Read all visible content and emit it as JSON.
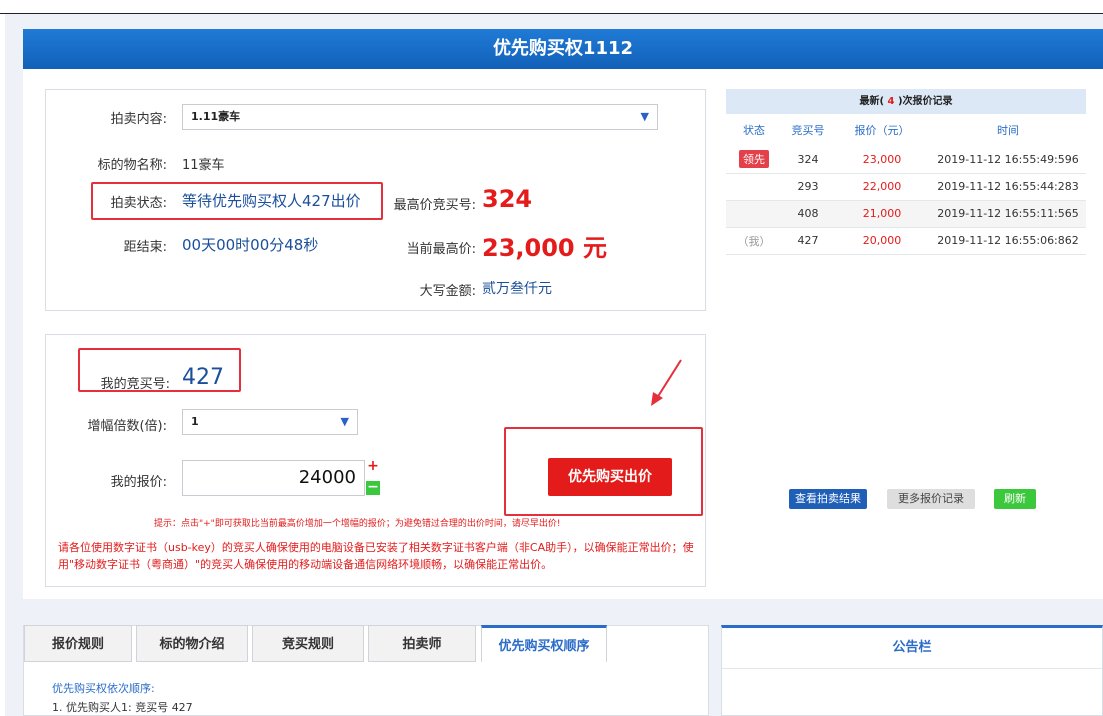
{
  "banner": {
    "title": "优先购买权1112"
  },
  "auction": {
    "content_label": "拍卖内容:",
    "content_value": "1.11豪车",
    "item_name_label": "标的物名称:",
    "item_name_value": "11豪车",
    "status_label": "拍卖状态:",
    "status_value": "等待优先购买权人427出价",
    "highest_bidder_label": "最高价竞买号:",
    "highest_bidder_value": "324",
    "countdown_label": "距结束:",
    "countdown_value": "00天00时00分48秒",
    "current_price_label": "当前最高价:",
    "current_price_value": "23,000 元",
    "capital_amount_label": "大写金额:",
    "capital_amount_value": "贰万叁仟元"
  },
  "bid": {
    "my_number_label": "我的竞买号:",
    "my_number_value": "427",
    "multiple_label": "增幅倍数(倍):",
    "multiple_value": "1",
    "my_price_label": "我的报价:",
    "my_price_value": "24000",
    "plus": "+",
    "minus": "−",
    "bid_button": "优先购买出价",
    "tip": "提示：点击\"+\"即可获取比当前最高价增加一个增幅的报价；为避免错过合理的出价时间，请尽早出价!",
    "warning": "请各位使用数字证书（usb-key）的竞买人确保使用的电脑设备已安装了相关数字证书客户端（非CA助手），以确保能正常出价；使用\"移动数字证书（粤商通）\"的竞买人确保使用的移动端设备通信网络环境顺畅，以确保能正常出价。"
  },
  "records": {
    "title_prefix": "最新(",
    "count": "4",
    "title_suffix": ")次报价记录",
    "columns": [
      "状态",
      "竞买号",
      "报价（元）",
      "时间"
    ],
    "rows": [
      {
        "status": "领先",
        "number": "324",
        "price": "23,000",
        "time": "2019-11-12 16:55:49:596"
      },
      {
        "status": "",
        "number": "293",
        "price": "22,000",
        "time": "2019-11-12 16:55:44:283"
      },
      {
        "status": "",
        "number": "408",
        "price": "21,000",
        "time": "2019-11-12 16:55:11:565"
      },
      {
        "status": "（我）",
        "number": "427",
        "price": "20,000",
        "time": "2019-11-12 16:55:06:862"
      }
    ],
    "view_result": "查看拍卖结果",
    "more_records": "更多报价记录",
    "refresh": "刷新"
  },
  "tabs": {
    "items": [
      "报价规则",
      "标的物介绍",
      "竞买规则",
      "拍卖师",
      "优先购买权顺序"
    ],
    "content_title": "优先购买权依次顺序:",
    "content_line": "1. 优先购买人1:  竞买号 427"
  },
  "notice": {
    "title": "公告栏"
  },
  "colors": {
    "brand_blue": "#1260b8",
    "accent_red": "#e41b1b",
    "highlight_box": "#e4303a",
    "refresh_green": "#3cc83c"
  }
}
